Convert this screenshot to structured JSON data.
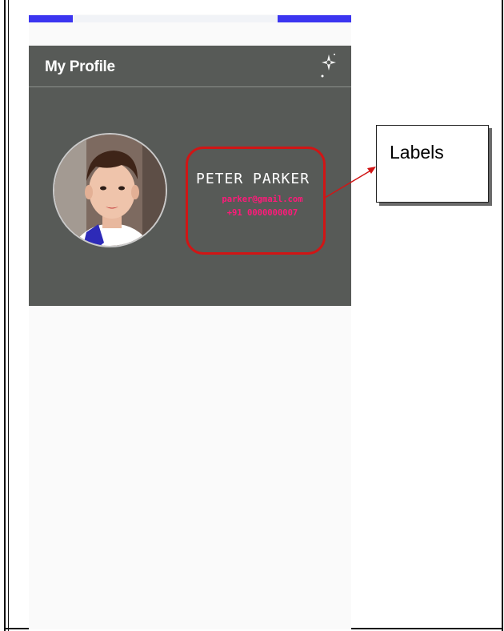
{
  "card": {
    "title": "My Profile"
  },
  "profile": {
    "name": "PETER PARKER",
    "email": "parker@gmail.com",
    "phone": "+91 0000000007"
  },
  "annotation": {
    "callout_label": "Labels"
  },
  "icons": {
    "header_action": "sparkle-icon",
    "avatar": "profile-photo"
  },
  "colors": {
    "card_background": "#575a57",
    "accent_blue": "#3b35f0",
    "label_highlight": "#d11515",
    "secondary_text": "#ff1a7a"
  }
}
